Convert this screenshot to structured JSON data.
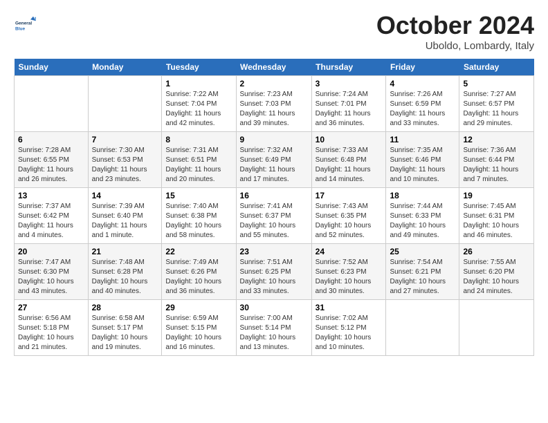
{
  "header": {
    "logo_general": "General",
    "logo_blue": "Blue",
    "month": "October 2024",
    "location": "Uboldo, Lombardy, Italy"
  },
  "days_of_week": [
    "Sunday",
    "Monday",
    "Tuesday",
    "Wednesday",
    "Thursday",
    "Friday",
    "Saturday"
  ],
  "weeks": [
    [
      {
        "day": "",
        "sunrise": "",
        "sunset": "",
        "daylight": ""
      },
      {
        "day": "",
        "sunrise": "",
        "sunset": "",
        "daylight": ""
      },
      {
        "day": "1",
        "sunrise": "Sunrise: 7:22 AM",
        "sunset": "Sunset: 7:04 PM",
        "daylight": "Daylight: 11 hours and 42 minutes."
      },
      {
        "day": "2",
        "sunrise": "Sunrise: 7:23 AM",
        "sunset": "Sunset: 7:03 PM",
        "daylight": "Daylight: 11 hours and 39 minutes."
      },
      {
        "day": "3",
        "sunrise": "Sunrise: 7:24 AM",
        "sunset": "Sunset: 7:01 PM",
        "daylight": "Daylight: 11 hours and 36 minutes."
      },
      {
        "day": "4",
        "sunrise": "Sunrise: 7:26 AM",
        "sunset": "Sunset: 6:59 PM",
        "daylight": "Daylight: 11 hours and 33 minutes."
      },
      {
        "day": "5",
        "sunrise": "Sunrise: 7:27 AM",
        "sunset": "Sunset: 6:57 PM",
        "daylight": "Daylight: 11 hours and 29 minutes."
      }
    ],
    [
      {
        "day": "6",
        "sunrise": "Sunrise: 7:28 AM",
        "sunset": "Sunset: 6:55 PM",
        "daylight": "Daylight: 11 hours and 26 minutes."
      },
      {
        "day": "7",
        "sunrise": "Sunrise: 7:30 AM",
        "sunset": "Sunset: 6:53 PM",
        "daylight": "Daylight: 11 hours and 23 minutes."
      },
      {
        "day": "8",
        "sunrise": "Sunrise: 7:31 AM",
        "sunset": "Sunset: 6:51 PM",
        "daylight": "Daylight: 11 hours and 20 minutes."
      },
      {
        "day": "9",
        "sunrise": "Sunrise: 7:32 AM",
        "sunset": "Sunset: 6:49 PM",
        "daylight": "Daylight: 11 hours and 17 minutes."
      },
      {
        "day": "10",
        "sunrise": "Sunrise: 7:33 AM",
        "sunset": "Sunset: 6:48 PM",
        "daylight": "Daylight: 11 hours and 14 minutes."
      },
      {
        "day": "11",
        "sunrise": "Sunrise: 7:35 AM",
        "sunset": "Sunset: 6:46 PM",
        "daylight": "Daylight: 11 hours and 10 minutes."
      },
      {
        "day": "12",
        "sunrise": "Sunrise: 7:36 AM",
        "sunset": "Sunset: 6:44 PM",
        "daylight": "Daylight: 11 hours and 7 minutes."
      }
    ],
    [
      {
        "day": "13",
        "sunrise": "Sunrise: 7:37 AM",
        "sunset": "Sunset: 6:42 PM",
        "daylight": "Daylight: 11 hours and 4 minutes."
      },
      {
        "day": "14",
        "sunrise": "Sunrise: 7:39 AM",
        "sunset": "Sunset: 6:40 PM",
        "daylight": "Daylight: 11 hours and 1 minute."
      },
      {
        "day": "15",
        "sunrise": "Sunrise: 7:40 AM",
        "sunset": "Sunset: 6:38 PM",
        "daylight": "Daylight: 10 hours and 58 minutes."
      },
      {
        "day": "16",
        "sunrise": "Sunrise: 7:41 AM",
        "sunset": "Sunset: 6:37 PM",
        "daylight": "Daylight: 10 hours and 55 minutes."
      },
      {
        "day": "17",
        "sunrise": "Sunrise: 7:43 AM",
        "sunset": "Sunset: 6:35 PM",
        "daylight": "Daylight: 10 hours and 52 minutes."
      },
      {
        "day": "18",
        "sunrise": "Sunrise: 7:44 AM",
        "sunset": "Sunset: 6:33 PM",
        "daylight": "Daylight: 10 hours and 49 minutes."
      },
      {
        "day": "19",
        "sunrise": "Sunrise: 7:45 AM",
        "sunset": "Sunset: 6:31 PM",
        "daylight": "Daylight: 10 hours and 46 minutes."
      }
    ],
    [
      {
        "day": "20",
        "sunrise": "Sunrise: 7:47 AM",
        "sunset": "Sunset: 6:30 PM",
        "daylight": "Daylight: 10 hours and 43 minutes."
      },
      {
        "day": "21",
        "sunrise": "Sunrise: 7:48 AM",
        "sunset": "Sunset: 6:28 PM",
        "daylight": "Daylight: 10 hours and 40 minutes."
      },
      {
        "day": "22",
        "sunrise": "Sunrise: 7:49 AM",
        "sunset": "Sunset: 6:26 PM",
        "daylight": "Daylight: 10 hours and 36 minutes."
      },
      {
        "day": "23",
        "sunrise": "Sunrise: 7:51 AM",
        "sunset": "Sunset: 6:25 PM",
        "daylight": "Daylight: 10 hours and 33 minutes."
      },
      {
        "day": "24",
        "sunrise": "Sunrise: 7:52 AM",
        "sunset": "Sunset: 6:23 PM",
        "daylight": "Daylight: 10 hours and 30 minutes."
      },
      {
        "day": "25",
        "sunrise": "Sunrise: 7:54 AM",
        "sunset": "Sunset: 6:21 PM",
        "daylight": "Daylight: 10 hours and 27 minutes."
      },
      {
        "day": "26",
        "sunrise": "Sunrise: 7:55 AM",
        "sunset": "Sunset: 6:20 PM",
        "daylight": "Daylight: 10 hours and 24 minutes."
      }
    ],
    [
      {
        "day": "27",
        "sunrise": "Sunrise: 6:56 AM",
        "sunset": "Sunset: 5:18 PM",
        "daylight": "Daylight: 10 hours and 21 minutes."
      },
      {
        "day": "28",
        "sunrise": "Sunrise: 6:58 AM",
        "sunset": "Sunset: 5:17 PM",
        "daylight": "Daylight: 10 hours and 19 minutes."
      },
      {
        "day": "29",
        "sunrise": "Sunrise: 6:59 AM",
        "sunset": "Sunset: 5:15 PM",
        "daylight": "Daylight: 10 hours and 16 minutes."
      },
      {
        "day": "30",
        "sunrise": "Sunrise: 7:00 AM",
        "sunset": "Sunset: 5:14 PM",
        "daylight": "Daylight: 10 hours and 13 minutes."
      },
      {
        "day": "31",
        "sunrise": "Sunrise: 7:02 AM",
        "sunset": "Sunset: 5:12 PM",
        "daylight": "Daylight: 10 hours and 10 minutes."
      },
      {
        "day": "",
        "sunrise": "",
        "sunset": "",
        "daylight": ""
      },
      {
        "day": "",
        "sunrise": "",
        "sunset": "",
        "daylight": ""
      }
    ]
  ]
}
